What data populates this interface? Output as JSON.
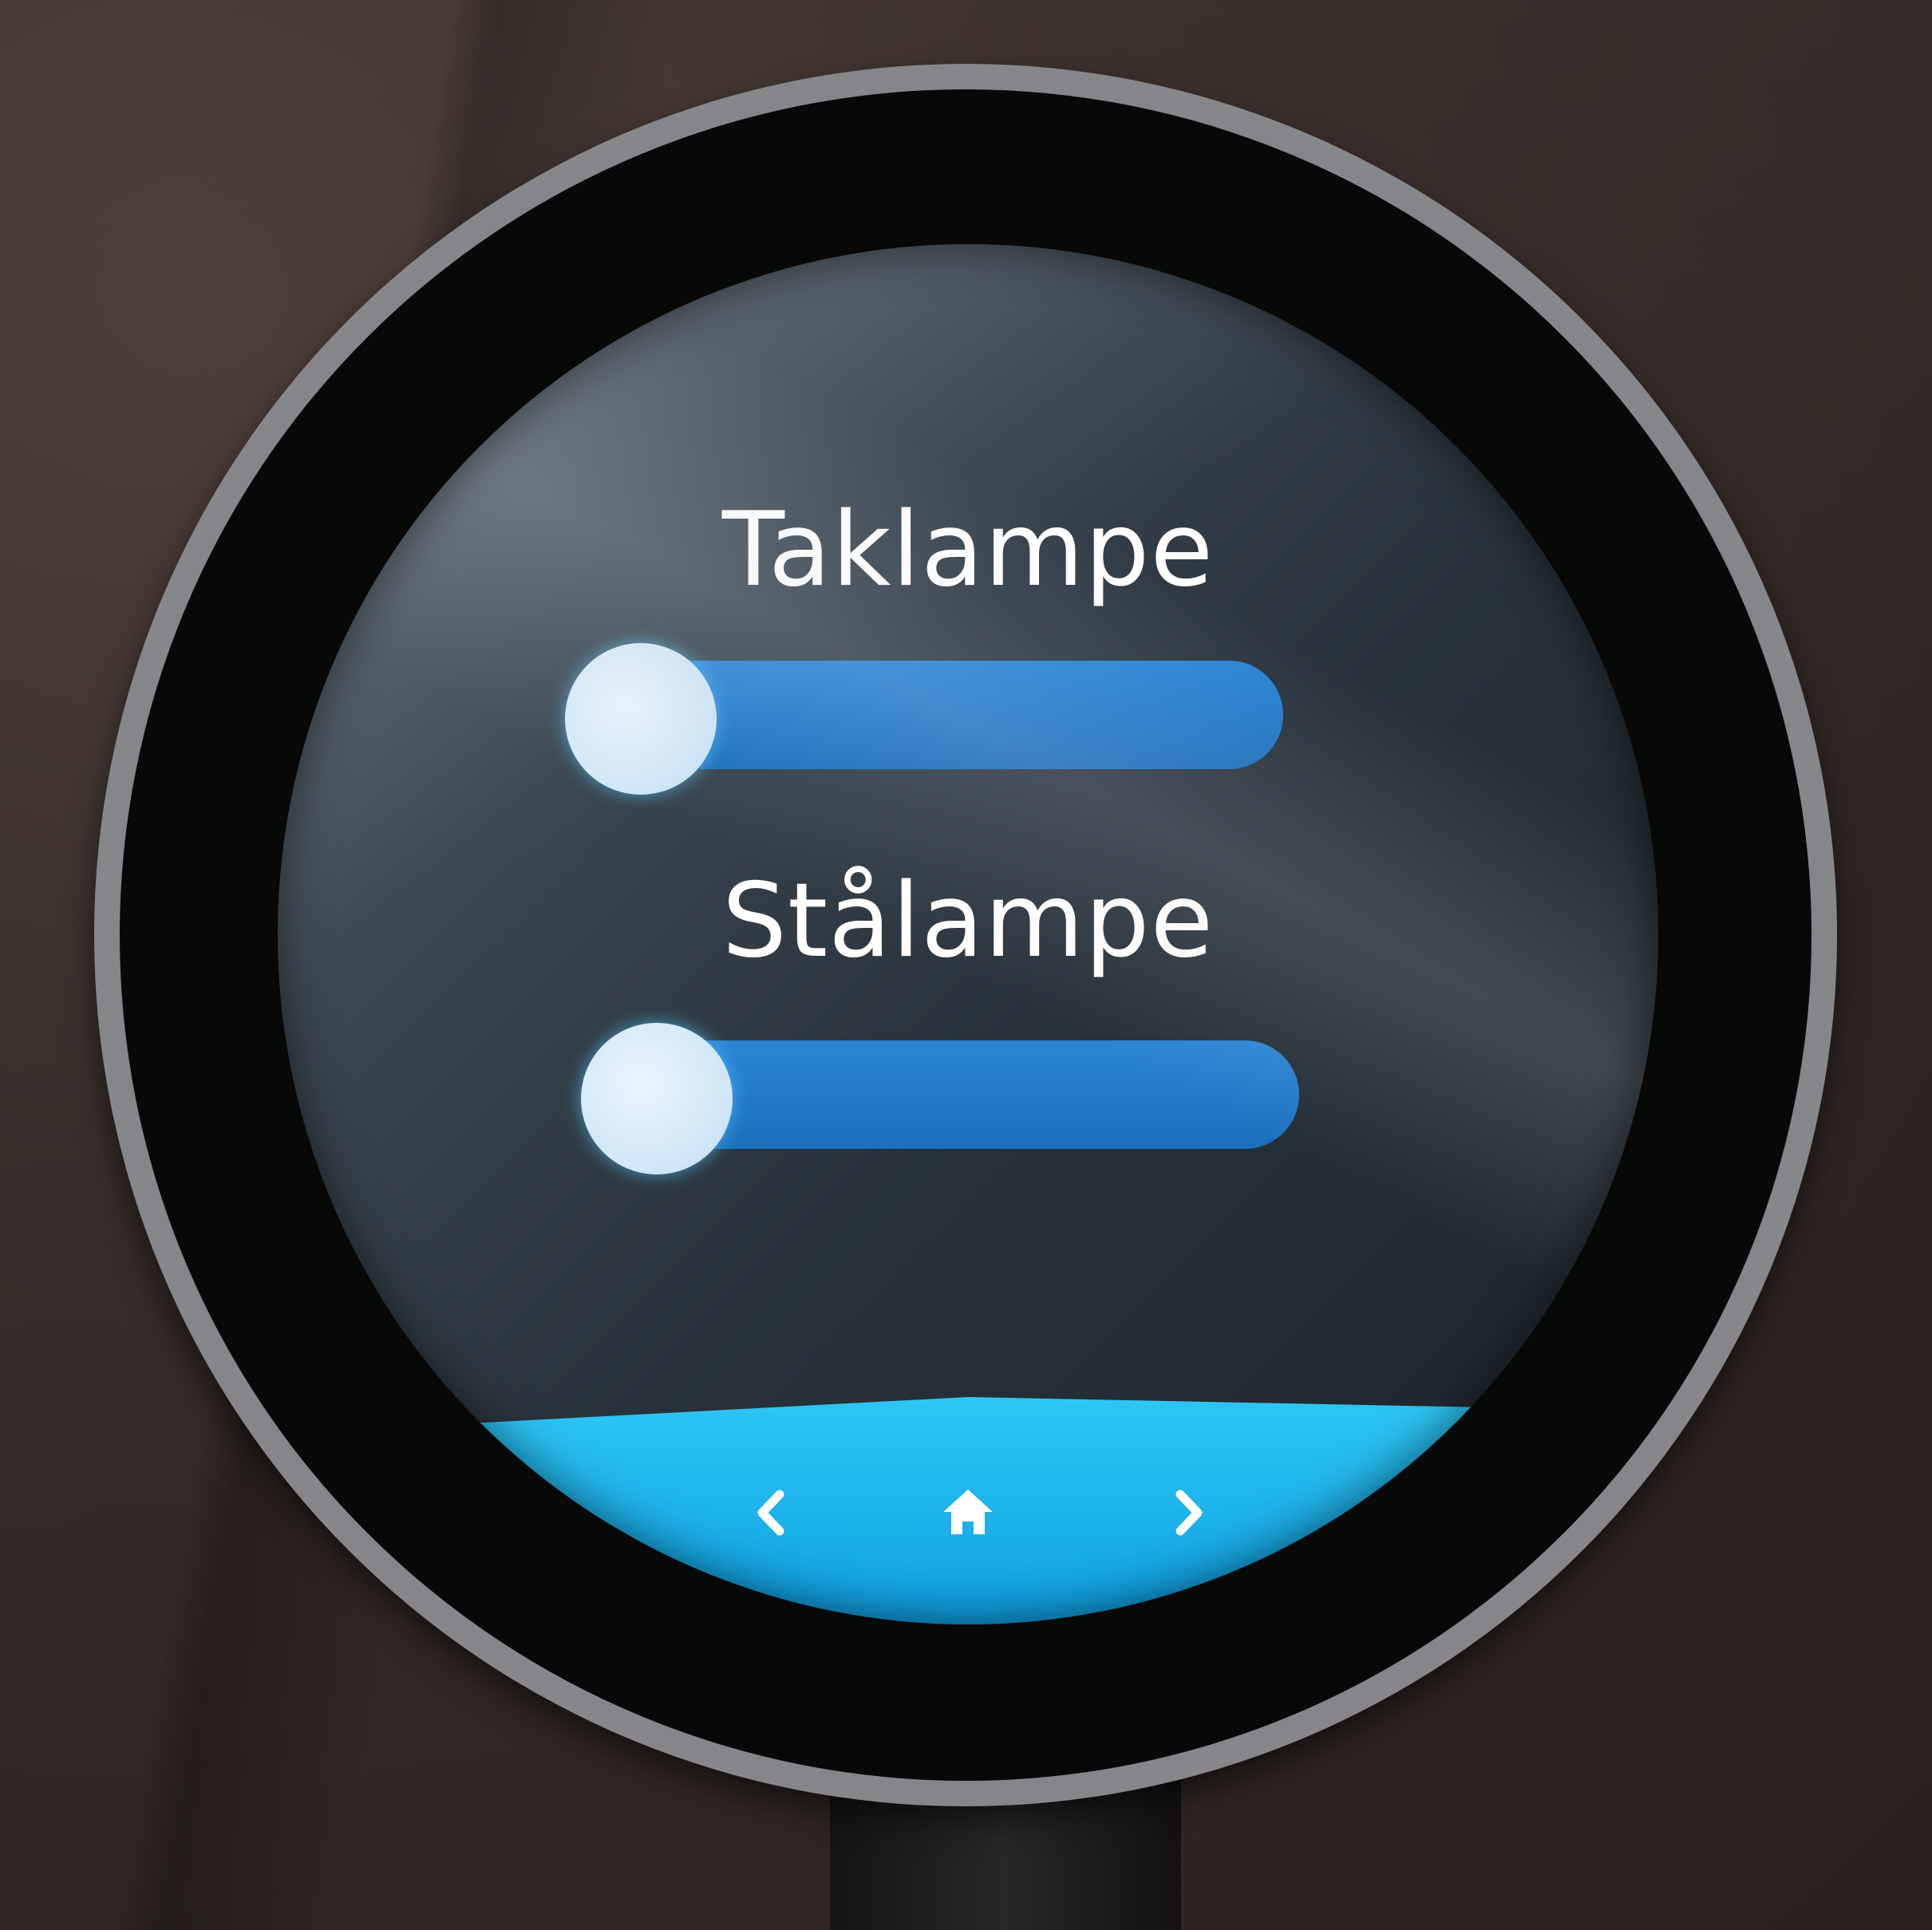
{
  "device": {
    "screen": {
      "controls": [
        {
          "label": "Taklampe",
          "slider": {
            "value": 0
          }
        },
        {
          "label": "Stålampe",
          "slider": {
            "value": 0
          }
        }
      ],
      "navbar": {
        "prev_icon": "chevron-left-icon",
        "home_icon": "home-icon",
        "next_icon": "chevron-right-icon"
      }
    },
    "colors": {
      "slider_track": "#1b6fbd",
      "slider_knob": "#cfe6f7",
      "navbar": "#15a8e6",
      "text": "#ffffff"
    }
  }
}
